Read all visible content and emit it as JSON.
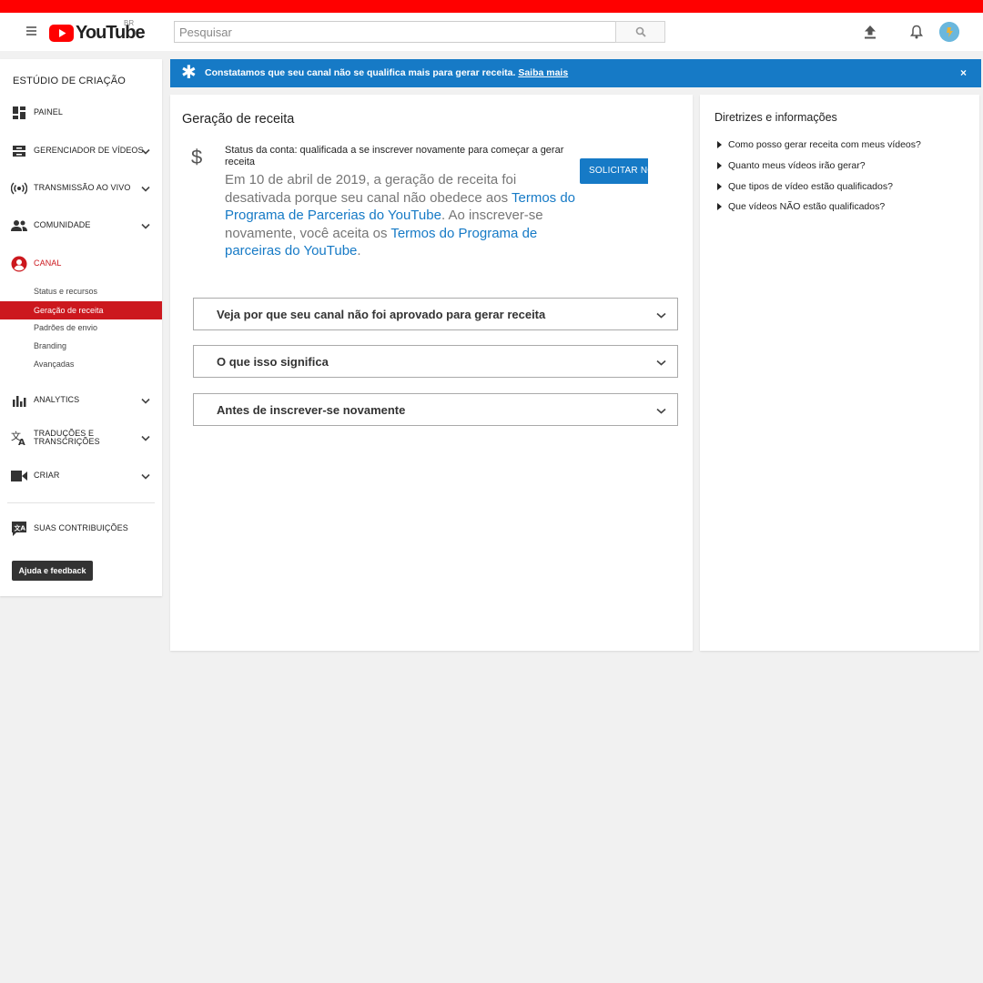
{
  "header": {
    "logo_text": "YouTube",
    "country_code": "BR",
    "search_placeholder": "Pesquisar",
    "colors": {
      "brand_red": "#ff0000",
      "accent_blue": "#167ac6"
    }
  },
  "sidebar": {
    "title": "ESTÚDIO DE CRIAÇÃO",
    "items": [
      {
        "label": "PAINEL",
        "icon": "dashboard-icon"
      },
      {
        "label": "GERENCIADOR DE VÍDEOS",
        "icon": "video-manager-icon"
      },
      {
        "label": "TRANSMISSÃO AO VIVO",
        "icon": "live-broadcast-icon"
      },
      {
        "label": "COMUNIDADE",
        "icon": "community-icon"
      },
      {
        "label": "CANAL",
        "icon": "channel-icon"
      },
      {
        "label": "ANALYTICS",
        "icon": "analytics-icon"
      },
      {
        "label": "TRADUÇÕES E TRANSCRIÇÕES",
        "icon": "translate-icon"
      },
      {
        "label": "CRIAR",
        "icon": "create-video-icon"
      },
      {
        "label": "SUAS CONTRIBUIÇÕES",
        "icon": "contributions-icon"
      }
    ],
    "channel_subitems": [
      {
        "label": "Status e recursos"
      },
      {
        "label": "Geração de receita"
      },
      {
        "label": "Padrões de envio"
      },
      {
        "label": "Branding"
      },
      {
        "label": "Avançadas"
      }
    ],
    "help_button": "Ajuda e feedback"
  },
  "banner": {
    "text": "Constatamos que seu canal não se qualifica mais para gerar receita.",
    "link": "Saiba mais",
    "close": "×"
  },
  "main": {
    "title": "Geração de receita",
    "dollar_symbol": "$",
    "status": "Status da conta: qualificada a se inscrever novamente para começar a gerar receita",
    "desc_part1": "Em 10 de abril de 2019, a geração de receita foi desativada porque seu canal não obedece aos ",
    "desc_link1": "Termos do Programa de Parcerias do YouTube",
    "desc_part2": ". Ao inscrever-se novamente, você aceita os ",
    "desc_link2": "Termos do Programa de parceiras do YouTube",
    "desc_part3": ".",
    "apply_button": "SOLICITAR NO",
    "accordions": [
      {
        "label": "Veja por que seu canal não foi aprovado para gerar receita"
      },
      {
        "label": "O que isso significa"
      },
      {
        "label": "Antes de inscrever-se novamente"
      }
    ]
  },
  "aside": {
    "title": "Diretrizes e informações",
    "links": [
      "Como posso gerar receita com meus vídeos?",
      "Quanto meus vídeos irão gerar?",
      "Que tipos de vídeo estão qualificados?",
      "Que vídeos NÃO estão qualificados?"
    ]
  }
}
